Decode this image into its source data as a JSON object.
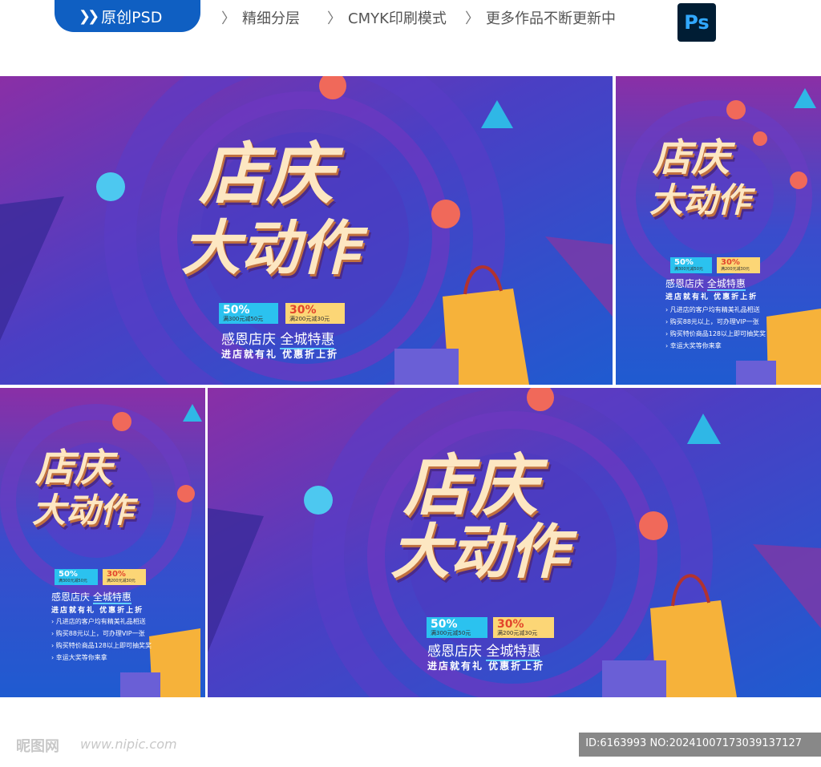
{
  "header": {
    "badge_label": "原创PSD",
    "features": [
      "精细分层",
      "CMYK印刷模式",
      "更多作品不断更新中"
    ],
    "ps_icon_label": "Ps"
  },
  "poster": {
    "title_line1": "店庆",
    "title_line2": "大动作",
    "coupon_1_pct": "50%",
    "coupon_1_text": "满300元减50元",
    "coupon_2_pct": "30%",
    "coupon_2_text": "满200元减30元",
    "slogan_a": "感恩店庆",
    "slogan_b": "全城特惠",
    "subline": "进店就有礼 优惠折上折",
    "bullets": [
      "凡进店的客户均有精美礼品相送",
      "购买88元以上，可办理VIP一张",
      "购买特价商品128以上即可抽奖奖",
      "幸运大奖等你来拿"
    ]
  },
  "colors": {
    "bg_blue": "#2b55c8",
    "bg_purple": "#8b2fa0",
    "accent_cream": "#fde7c2",
    "coupon_blue": "#2bc2ef",
    "coupon_yellow": "#fcd676",
    "bag_orange": "#f6b23a"
  },
  "footer": {
    "logo": "昵图网",
    "url": "www.nipic.com",
    "id_text": "ID:6163993 NO:20241007173039137127"
  }
}
